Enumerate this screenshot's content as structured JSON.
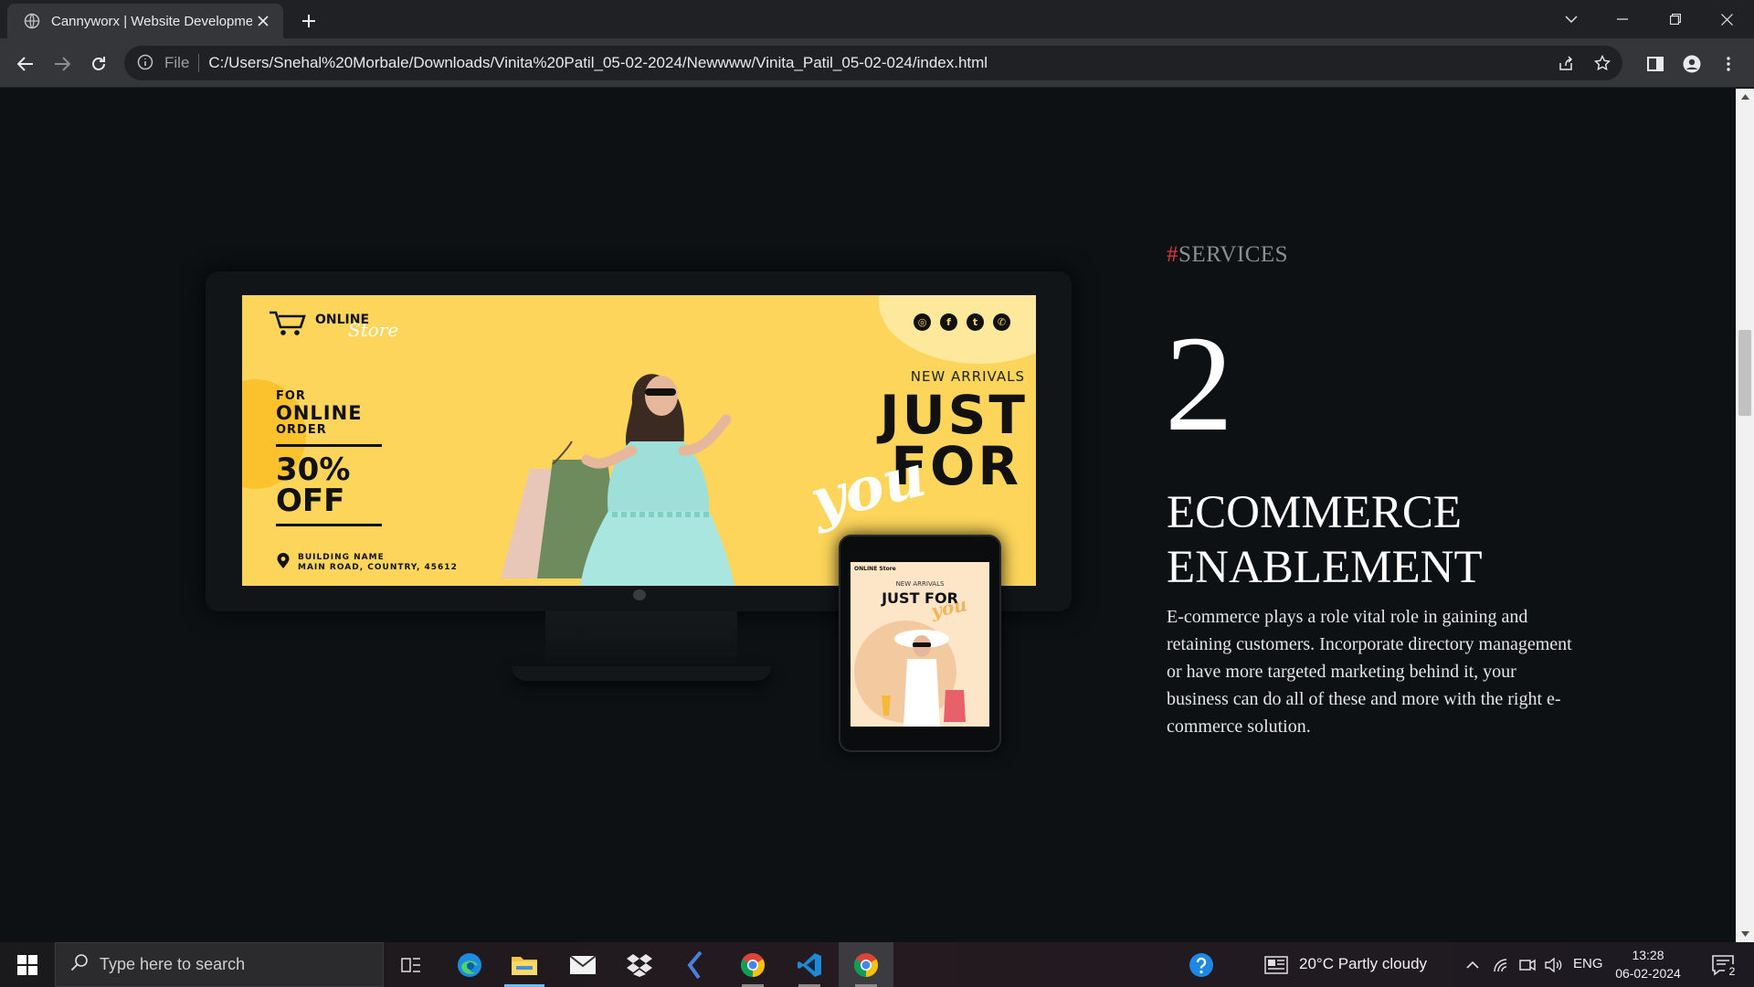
{
  "browser": {
    "tab_title": "Cannyworx | Website Development",
    "address_scheme": "File",
    "address_url": "C:/Users/Snehal%20Morbale/Downloads/Vinita%20Patil_05-02-2024/Newwww/Vinita_Patil_05-02-024/index.html"
  },
  "banner": {
    "logo_word": "ONLINE",
    "logo_script": "Store",
    "offer_for": "FOR",
    "offer_online": "ONLINE",
    "offer_order": "ORDER",
    "offer_percent": "30%",
    "offer_off": "OFF",
    "address_line1": "BUILDING NAME",
    "address_line2": "MAIN ROAD, COUNTRY, 45612",
    "new_arrivals": "NEW ARRIVALS",
    "just": "JUST",
    "for": "FOR",
    "you": "you",
    "social_icons": [
      "instagram-icon",
      "facebook-icon",
      "twitter-icon",
      "whatsapp-icon"
    ]
  },
  "phone_banner": {
    "logo": "ONLINE Store",
    "new_arrivals": "NEW ARRIVALS",
    "just_for": "JUST FOR",
    "you": "you"
  },
  "section": {
    "tag_hash": "#",
    "tag_label": "SERVICES",
    "number": "2",
    "heading_line1": "ECOMMERCE",
    "heading_line2": "ENABLEMENT",
    "body": "E-commerce plays a role vital role in gaining and retaining customers. Incorporate directory management or have more targeted marketing behind it, your business can do all of these and more with the right e-commerce solution."
  },
  "taskbar": {
    "search_placeholder": "Type here to search",
    "weather": "20°C  Partly cloudy",
    "language": "ENG",
    "time": "13:28",
    "date": "06-02-2024",
    "notification_count": "2"
  },
  "colors": {
    "page_bg": "#0d1114",
    "accent_red": "#e0393e",
    "banner_yellow": "#fcd55a"
  }
}
